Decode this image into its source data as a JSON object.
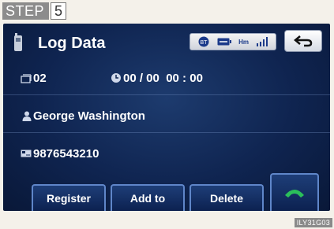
{
  "step": {
    "label": "STEP",
    "number": "5"
  },
  "header": {
    "title": "Log Data",
    "status": {
      "bt": "BT",
      "hm": "Hm",
      "signal_icon": "signal-bars-icon"
    },
    "back_icon": "back-arrow-icon"
  },
  "rows": {
    "entry": {
      "icon": "log-entry-icon",
      "number": "02",
      "time_icon": "clock-icon",
      "datetime": "00 / 00  00 : 00"
    },
    "contact": {
      "icon": "person-icon",
      "name": "George Washington"
    },
    "phone": {
      "icon": "phone-card-icon",
      "number": "9876543210"
    }
  },
  "buttons": {
    "register": "Register",
    "add_to": "Add to",
    "delete": "Delete",
    "call_icon": "call-handset-icon"
  },
  "colors": {
    "screen": "#0f2450",
    "accent": "#5f86c9",
    "call": "#2bbf5a"
  },
  "figure_code": "ILY31G03"
}
